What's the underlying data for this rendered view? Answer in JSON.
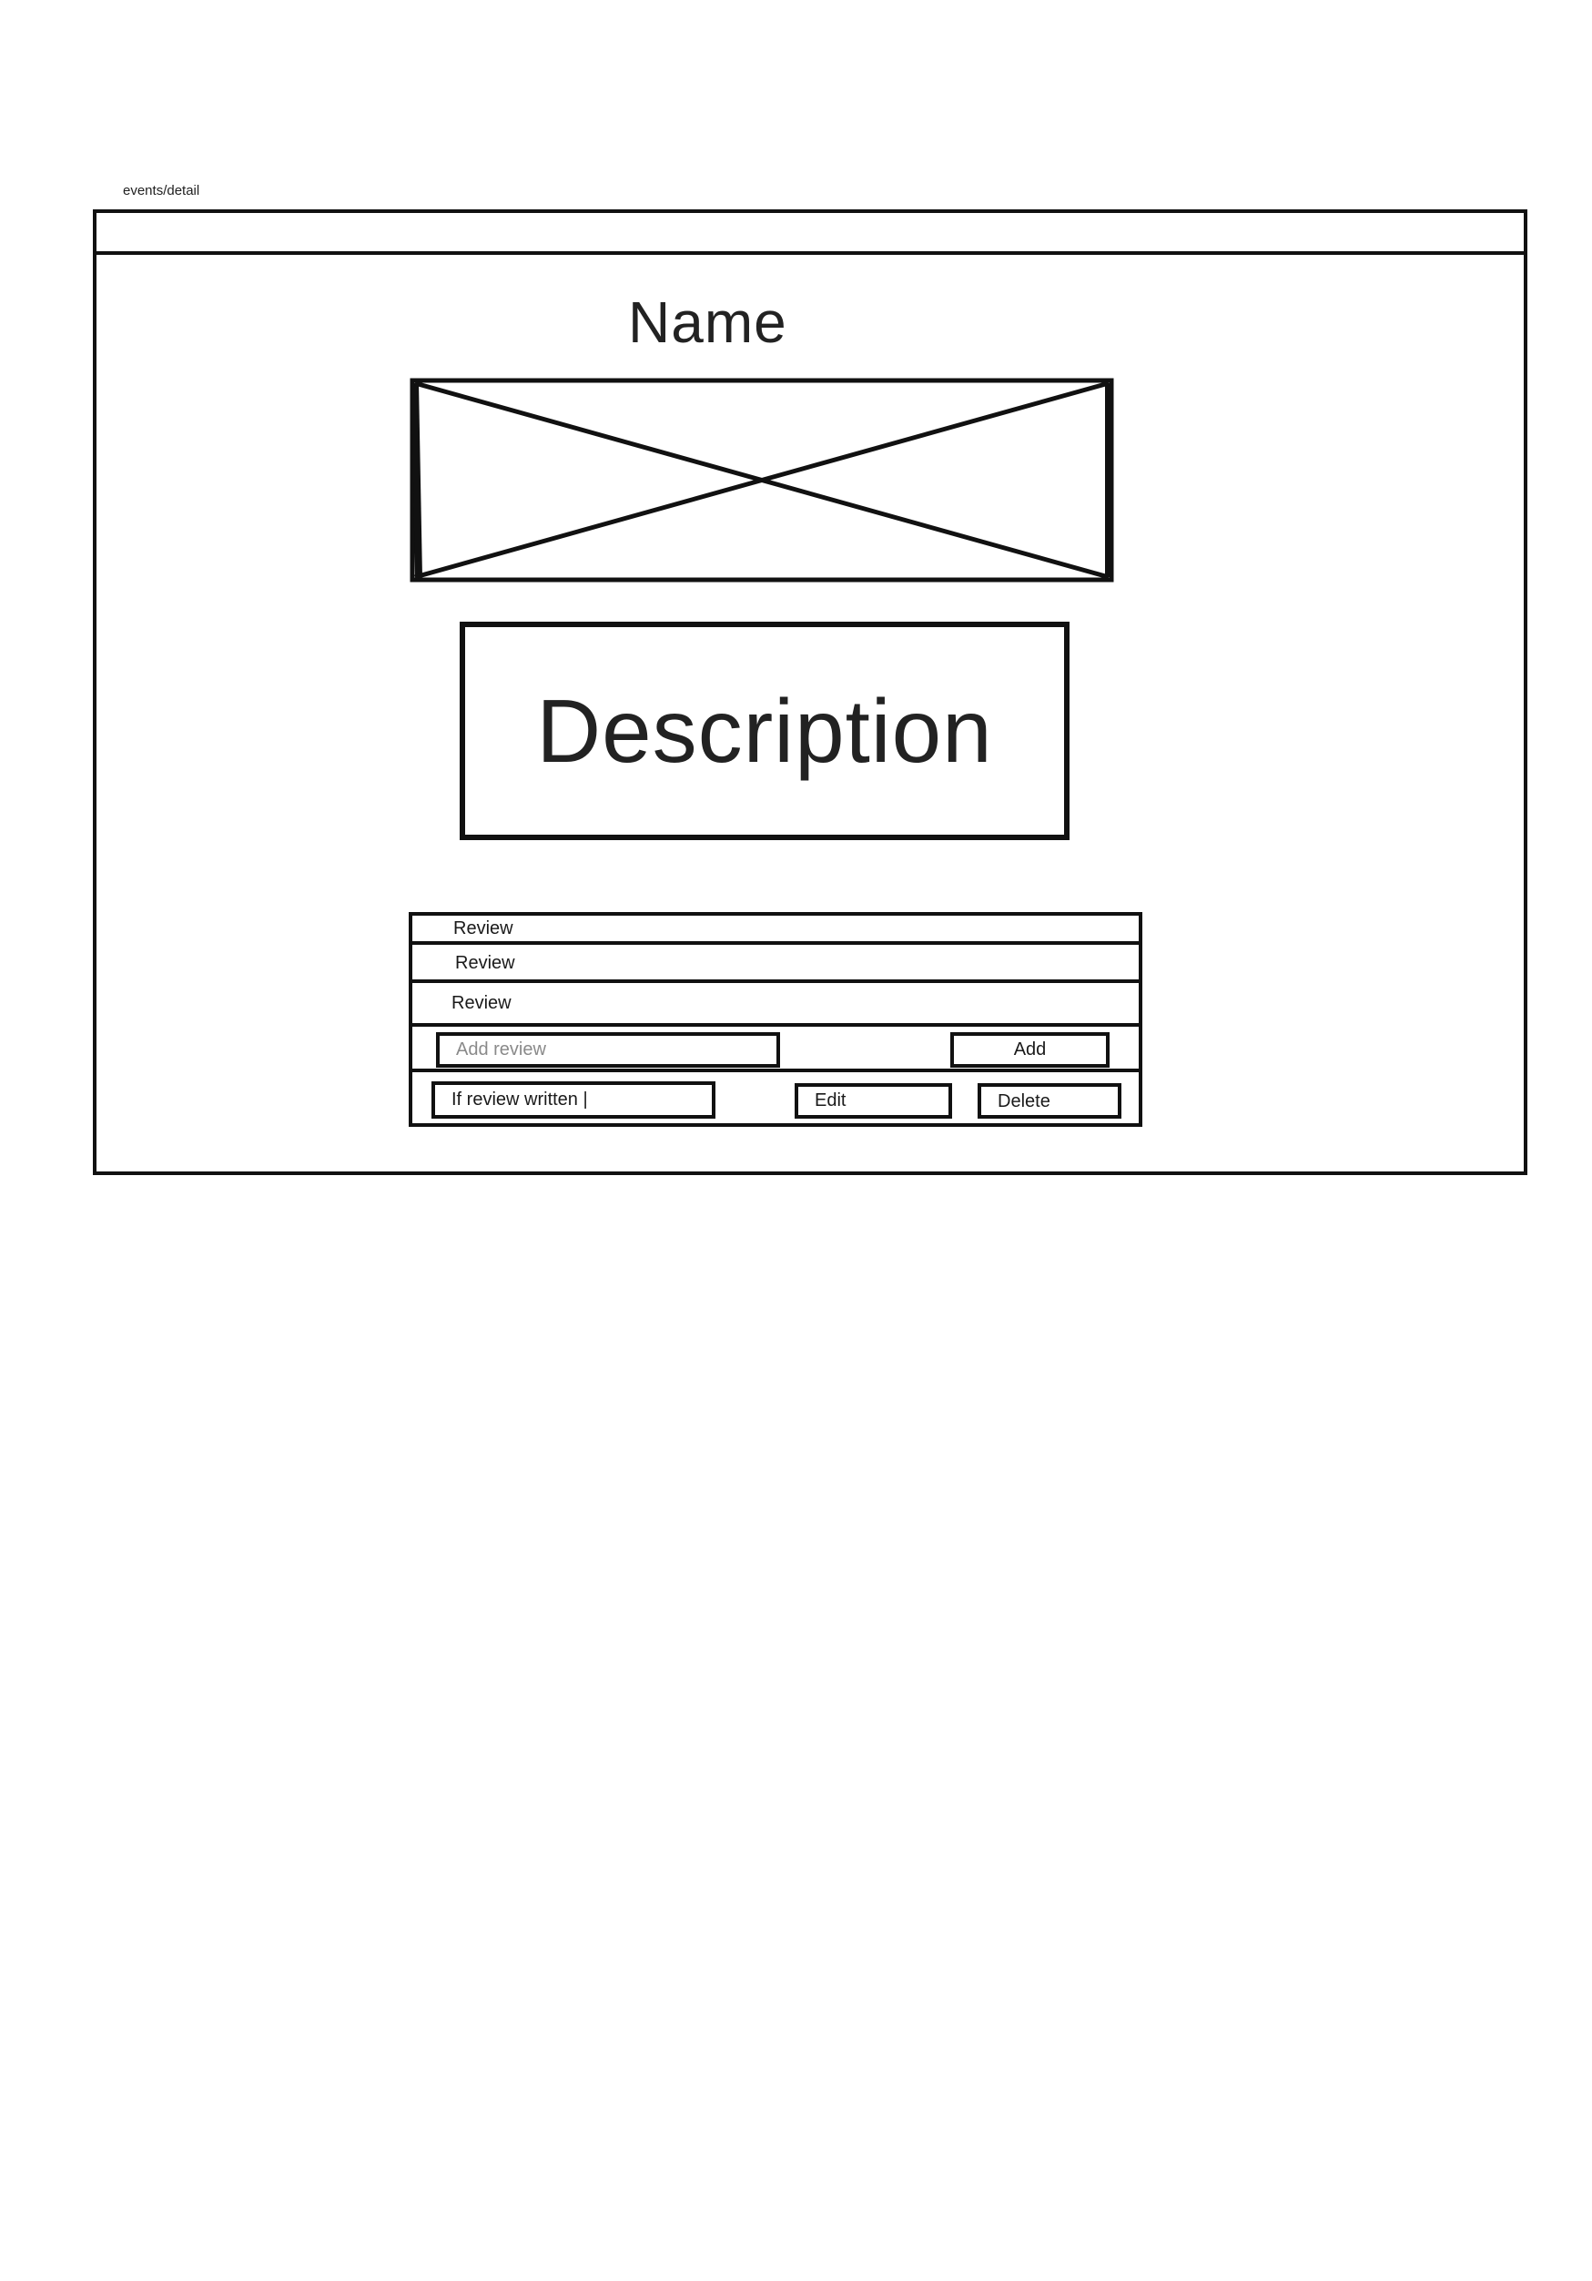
{
  "route": "events/detail",
  "event": {
    "name": "Name",
    "description": "Description"
  },
  "image": {
    "icon": "image-placeholder-icon"
  },
  "reviews": {
    "items": [
      {
        "text": "Review"
      },
      {
        "text": "Review"
      },
      {
        "text": "Review"
      }
    ],
    "add": {
      "placeholder": "Add review",
      "button_label": "Add"
    },
    "own": {
      "text": "If review written |",
      "edit_label": "Edit",
      "delete_label": "Delete"
    }
  }
}
